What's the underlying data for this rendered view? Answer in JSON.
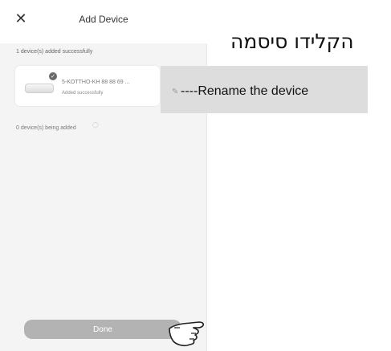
{
  "header": {
    "title": "Add Device",
    "close_icon": "close-icon"
  },
  "annotation": {
    "hebrew_heading": "הקלידו סיסמה",
    "rename_text": "Rename the device",
    "rename_prefix": "----"
  },
  "device_list": {
    "success_summary": "1 device(s) added successfully",
    "device": {
      "name": "5-KOTTHO-KH 88 88 69 ...",
      "status": "Added successfully"
    },
    "adding_summary": "0 device(s) being added"
  },
  "actions": {
    "done_label": "Done"
  },
  "colors": {
    "highlight": "#dddddd",
    "button": "#b3b3b3",
    "background": "#f4f4f4"
  }
}
